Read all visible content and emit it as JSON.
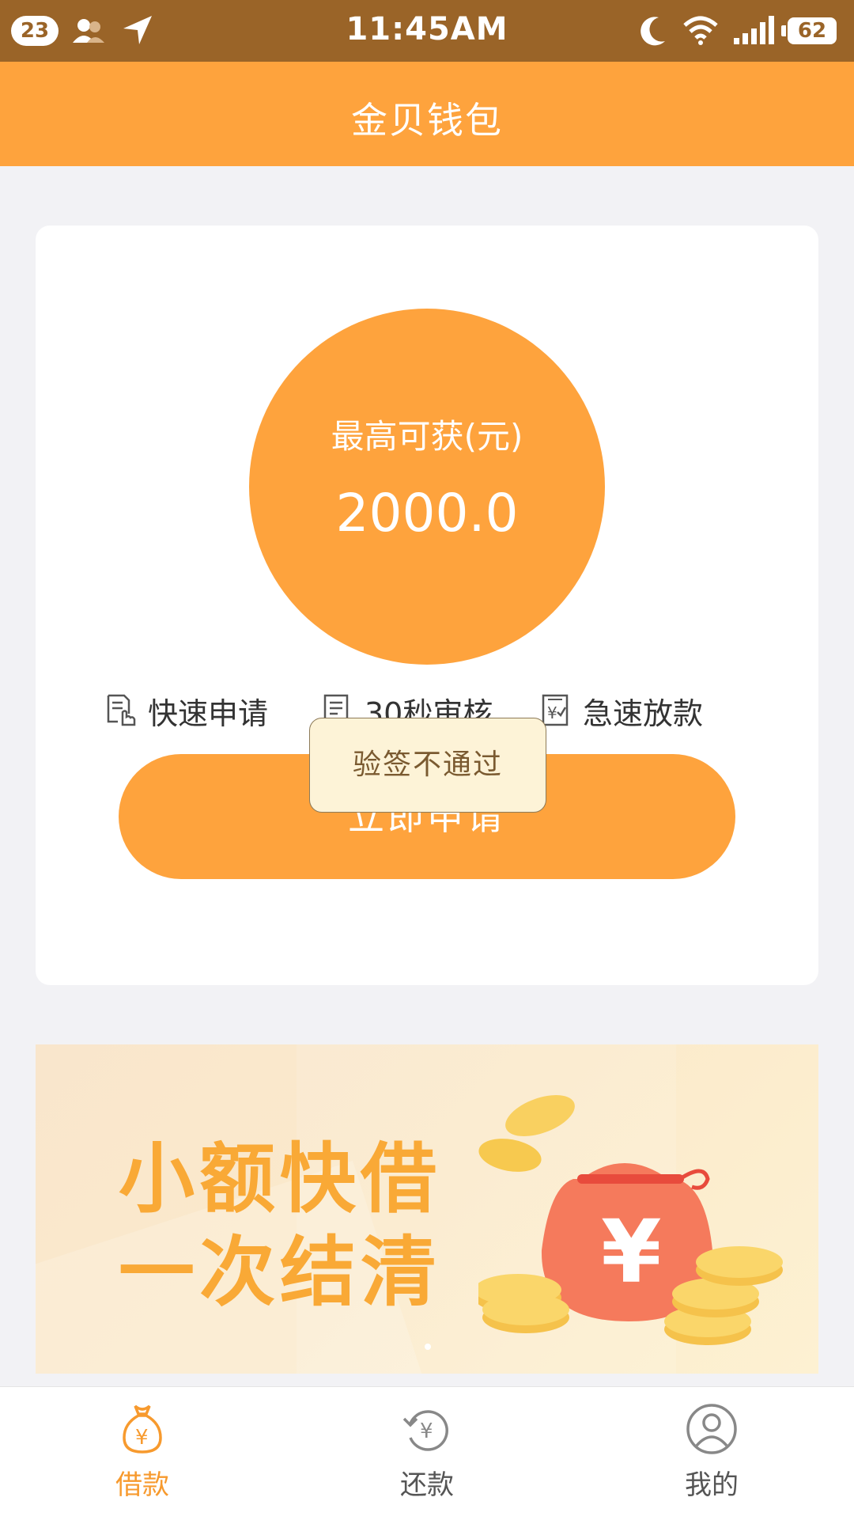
{
  "status_bar": {
    "notification_count": "23",
    "time": "11:45AM",
    "battery": "62"
  },
  "header": {
    "title": "金贝钱包"
  },
  "card": {
    "limit_label": "最高可获(元)",
    "limit_amount": "2000.0",
    "features": [
      {
        "label": "快速申请",
        "icon": "tap-document-icon"
      },
      {
        "label": "30秒审核",
        "icon": "review-document-icon"
      },
      {
        "label": "急速放款",
        "icon": "yuan-receipt-icon"
      }
    ],
    "apply_button": "立即申请"
  },
  "toast": {
    "message": "验签不通过"
  },
  "banner": {
    "line1": "小额快借",
    "line2": "一次结清"
  },
  "tabbar": {
    "tabs": [
      {
        "label": "借款",
        "icon": "money-bag-icon",
        "active": true
      },
      {
        "label": "还款",
        "icon": "repay-icon",
        "active": false
      },
      {
        "label": "我的",
        "icon": "profile-icon",
        "active": false
      }
    ]
  },
  "colors": {
    "accent": "#fea33d",
    "status_bar": "#9a6428",
    "background": "#f2f2f5"
  }
}
